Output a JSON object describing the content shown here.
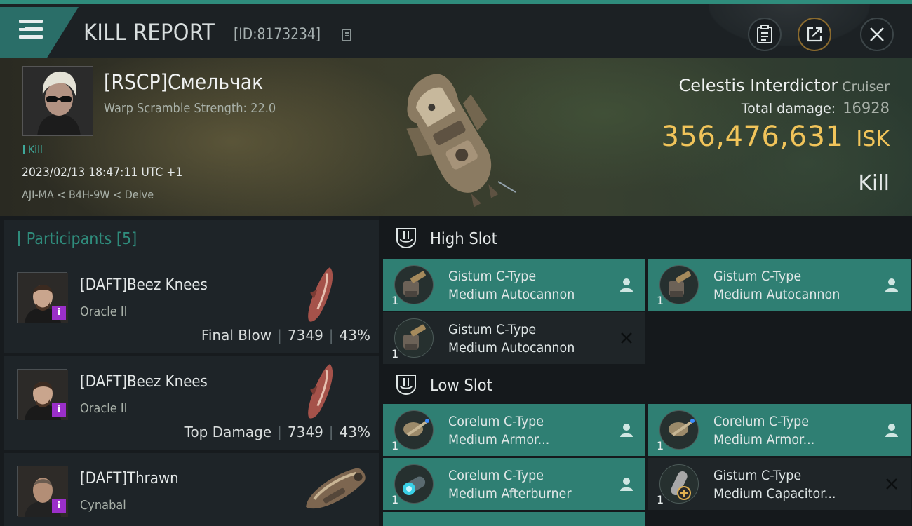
{
  "header": {
    "title": "KILL REPORT",
    "report_id": "[ID:8173234]"
  },
  "victim": {
    "name": "[RSCP]Смельчак",
    "scramble": "Warp Scramble Strength: 22.0",
    "tag": "Kill",
    "time": "2023/02/13 18:47:11 UTC +1",
    "location": "AJI-MA < B4H-9W < Delve",
    "ship_name": "Celestis Interdictor",
    "ship_class": "Cruiser",
    "total_damage_label": "Total damage:",
    "total_damage": "16928",
    "isk_value": "356,476,631",
    "isk_unit": "ISK",
    "result": "Kill"
  },
  "participants": {
    "title": "Participants [5]",
    "items": [
      {
        "name": "[DAFT]Beez Knees",
        "ship": "Oracle II",
        "role": "Final Blow",
        "damage": "7349",
        "percent": "43%",
        "badge": "i"
      },
      {
        "name": "[DAFT]Beez Knees",
        "ship": "Oracle II",
        "role": "Top Damage",
        "damage": "7349",
        "percent": "43%",
        "badge": "i"
      },
      {
        "name": "[DAFT]Thrawn",
        "ship": "Cynabal",
        "role": "",
        "damage": "",
        "percent": "",
        "badge": "i"
      }
    ]
  },
  "fitting": {
    "high_slot_title": "High Slot",
    "low_slot_title": "Low Slot",
    "high": [
      {
        "line1": "Gistum C-Type",
        "line2": "Medium Autocannon",
        "qty": "1",
        "status": "fitted"
      },
      {
        "line1": "Gistum C-Type",
        "line2": "Medium Autocannon",
        "qty": "1",
        "status": "fitted"
      },
      {
        "line1": "Gistum C-Type",
        "line2": "Medium Autocannon",
        "qty": "1",
        "status": "destroyed"
      }
    ],
    "low": [
      {
        "line1": "Corelum C-Type",
        "line2": "Medium Armor...",
        "qty": "1",
        "status": "fitted"
      },
      {
        "line1": "Corelum C-Type",
        "line2": "Medium Armor...",
        "qty": "1",
        "status": "fitted"
      },
      {
        "line1": "Corelum C-Type",
        "line2": "Medium Afterburner",
        "qty": "1",
        "status": "fitted"
      },
      {
        "line1": "Gistum C-Type",
        "line2": "Medium Capacitor...",
        "qty": "1",
        "status": "destroyed"
      }
    ]
  },
  "colors": {
    "accent": "#2f8c7c",
    "fitted": "#2f7f73",
    "isk": "#f1c45a",
    "badge": "#9b2fc9"
  },
  "icons": {
    "menu": "hamburger-menu-icon",
    "copy": "copy-icon",
    "clipboard": "clipboard-icon",
    "share": "share-icon",
    "close": "close-icon",
    "slot": "slot-shield-icon",
    "fitted": "person-icon",
    "destroyed": "x-icon"
  }
}
